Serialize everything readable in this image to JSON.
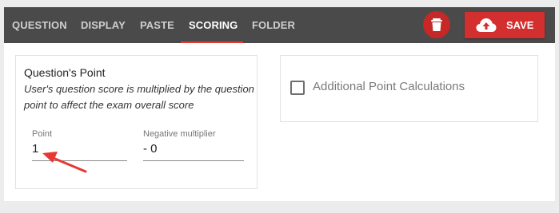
{
  "tabs": [
    {
      "label": "QUESTION",
      "active": false
    },
    {
      "label": "DISPLAY",
      "active": false
    },
    {
      "label": "PASTE",
      "active": false
    },
    {
      "label": "SCORING",
      "active": true
    },
    {
      "label": "FOLDER",
      "active": false
    }
  ],
  "toolbar": {
    "delete_icon": "trash-icon",
    "save_icon": "cloud-upload-icon",
    "save_label": "SAVE"
  },
  "scoring": {
    "title": "Question's Point",
    "description": "User's question score is multiplied by the question point to affect the exam overall score",
    "point": {
      "label": "Point",
      "value": "1"
    },
    "negative_multiplier": {
      "label": "Negative multiplier",
      "value": "- 0"
    }
  },
  "additional": {
    "label": "Additional Point Calculations",
    "checked": false
  },
  "colors": {
    "topbar": "#4a4a4a",
    "accent": "#d32f2f",
    "annotation_arrow": "#e53935"
  },
  "annotation": {
    "icon": "red-arrow-pointer"
  }
}
